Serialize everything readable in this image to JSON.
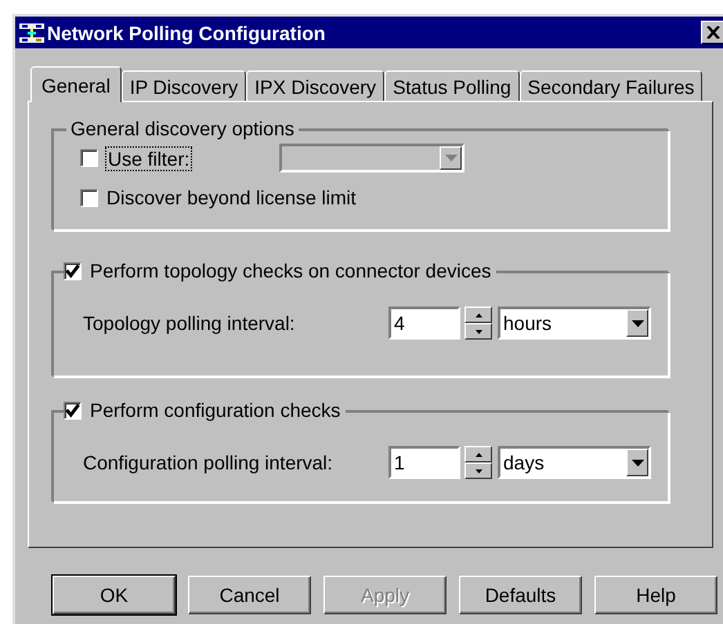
{
  "window": {
    "title": "Network Polling Configuration"
  },
  "tabs": [
    {
      "label": "General",
      "selected": true
    },
    {
      "label": "IP Discovery",
      "selected": false
    },
    {
      "label": "IPX Discovery",
      "selected": false
    },
    {
      "label": "Status Polling",
      "selected": false
    },
    {
      "label": "Secondary Failures",
      "selected": false
    }
  ],
  "general_discovery": {
    "title": "General discovery options",
    "use_filter": {
      "label": "Use filter:",
      "checked": false,
      "dropdown_disabled": true
    },
    "discover_beyond": {
      "label": "Discover beyond license limit",
      "checked": false
    }
  },
  "topology": {
    "label": "Perform topology checks on connector devices",
    "checked": true,
    "interval_label": "Topology polling interval:",
    "value": "4",
    "unit": "hours"
  },
  "configuration": {
    "label": "Perform configuration checks",
    "checked": true,
    "interval_label": "Configuration polling interval:",
    "value": "1",
    "unit": "days"
  },
  "buttons": [
    {
      "label": "OK",
      "disabled": false,
      "default": true
    },
    {
      "label": "Cancel",
      "disabled": false,
      "default": false
    },
    {
      "label": "Apply",
      "disabled": true,
      "default": false
    },
    {
      "label": "Defaults",
      "disabled": false,
      "default": false
    },
    {
      "label": "Help",
      "disabled": false,
      "default": false
    }
  ]
}
